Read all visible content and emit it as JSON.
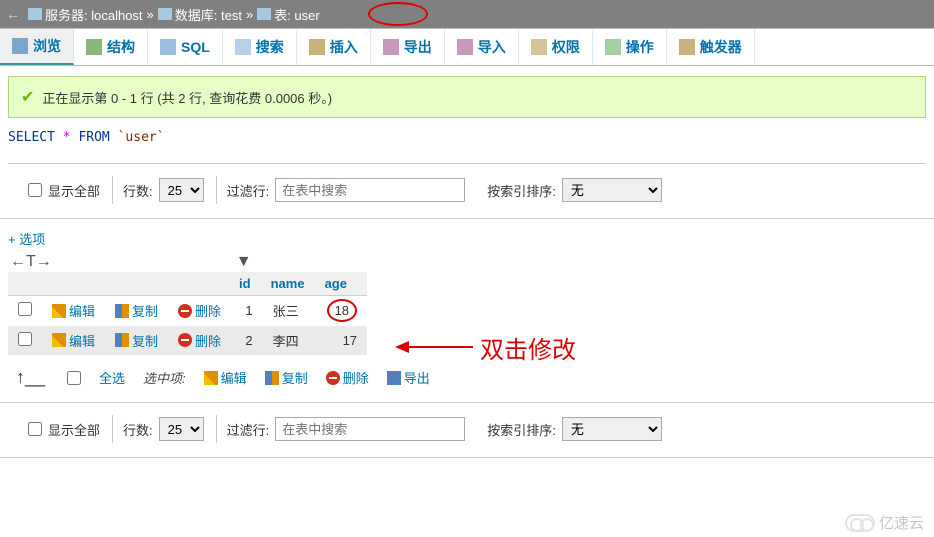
{
  "breadcrumb": {
    "server_label": "服务器: localhost",
    "db_label": "数据库: test",
    "table_label": "表: user"
  },
  "tabs": [
    {
      "label": "浏览"
    },
    {
      "label": "结构"
    },
    {
      "label": "SQL"
    },
    {
      "label": "搜索"
    },
    {
      "label": "插入"
    },
    {
      "label": "导出"
    },
    {
      "label": "导入"
    },
    {
      "label": "权限"
    },
    {
      "label": "操作"
    },
    {
      "label": "触发器"
    }
  ],
  "status": {
    "text": "正在显示第 0 - 1 行 (共 2 行, 查询花费 0.0006 秒。)"
  },
  "sql": {
    "select": "SELECT",
    "star": "*",
    "from": "FROM",
    "table": "`user`"
  },
  "toolbar": {
    "show_all": "显示全部",
    "rows_label": "行数:",
    "rows_value": "25",
    "filter_label": "过滤行:",
    "filter_placeholder": "在表中搜索",
    "sort_label": "按索引排序:",
    "sort_value": "无"
  },
  "options_link": "+ 选项",
  "columns": {
    "c0": "id",
    "c1": "name",
    "c2": "age"
  },
  "actions": {
    "edit": "编辑",
    "copy": "复制",
    "delete": "删除",
    "export": "导出"
  },
  "rows": [
    {
      "id": "1",
      "name": "张三",
      "age": "18"
    },
    {
      "id": "2",
      "name": "李四",
      "age": "17"
    }
  ],
  "batch": {
    "select_all": "全选",
    "selected_items": "选中项:"
  },
  "annotation": {
    "text": "双击修改"
  },
  "watermark": "亿速云"
}
